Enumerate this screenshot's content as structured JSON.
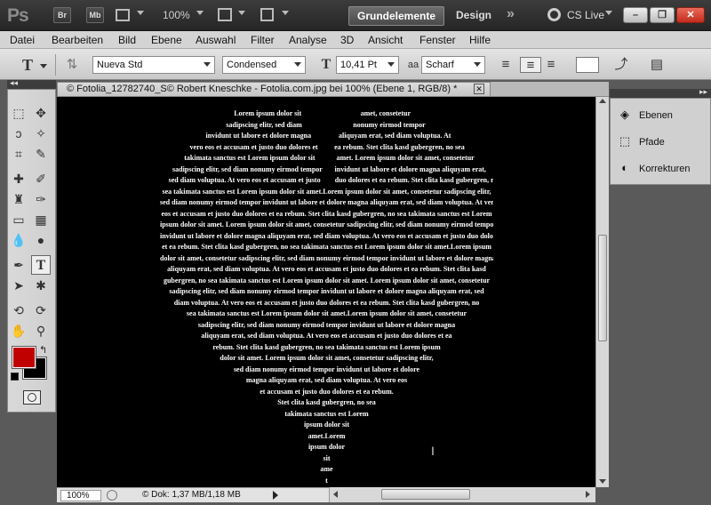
{
  "appbar": {
    "logo": "Ps",
    "br": "Br",
    "mb": "Mb",
    "zoom": "100%",
    "workspace_active": "Grundelemente",
    "workspace_design": "Design",
    "more": "»",
    "cslive": "CS Live"
  },
  "menu": [
    "Datei",
    "Bearbeiten",
    "Bild",
    "Ebene",
    "Auswahl",
    "Filter",
    "Analyse",
    "3D",
    "Ansicht",
    "Fenster",
    "Hilfe"
  ],
  "options": {
    "tool_glyph": "T",
    "font_family": "Nueva Std",
    "font_style": "Condensed",
    "font_size": "10,41 Pt",
    "aa_label": "aa",
    "antialias": "Scharf"
  },
  "document": {
    "tab_title": "© Fotolia_12782740_S© Robert Kneschke - Fotolia.com.jpg bei 100% (Ebene 1, RGB/8) *",
    "zoom": "100%",
    "doc_info": "© Dok: 1,37 MB/1,18 MB"
  },
  "text_lines": [
    [
      "Lorem ipsum dolor sit",
      "amet, consetetur"
    ],
    [
      "sadipscing elitr, sed diam",
      "nonumy eirmod tempor"
    ],
    [
      "invidunt ut labore et dolore magna",
      "aliquyam erat, sed diam voluptua. At"
    ],
    [
      "vero eos et accusam et justo duo dolores et",
      "ea rebum. Stet clita kasd gubergren, no sea"
    ],
    [
      "takimata sanctus est Lorem ipsum dolor sit",
      "amet. Lorem ipsum dolor sit amet, consetetur"
    ],
    [
      "sadipscing elitr, sed diam nonumy eirmod tempor",
      "invidunt ut labore et dolore magna aliquyam erat,"
    ],
    [
      "sed diam voluptua. At vero eos et accusam et justo",
      "duo dolores et ea rebum. Stet clita kasd gubergren, no"
    ],
    [
      "sea takimata sanctus est Lorem ipsum dolor sit amet.Lorem ipsum dolor sit amet, consetetur sadipscing elitr,"
    ],
    [
      "sed diam nonumy eirmod tempor invidunt ut labore et dolore magna aliquyam erat, sed diam voluptua. At vero"
    ],
    [
      "eos et accusam et justo duo dolores et ea rebum. Stet clita kasd gubergren, no sea takimata sanctus est Lorem"
    ],
    [
      "ipsum dolor sit amet. Lorem ipsum dolor sit amet, consetetur sadipscing elitr, sed diam nonumy eirmod tempor"
    ],
    [
      "invidunt ut labore et dolore magna aliquyam erat, sed diam voluptua. At vero eos et accusam et justo duo dolores"
    ],
    [
      "et ea rebum. Stet clita kasd gubergren, no sea takimata sanctus est Lorem ipsum dolor sit amet.Lorem ipsum"
    ],
    [
      "dolor sit amet, consetetur sadipscing elitr, sed diam nonumy eirmod tempor invidunt ut labore et dolore magna"
    ],
    [
      "aliquyam erat, sed diam voluptua. At vero eos et accusam et justo duo dolores et ea rebum. Stet clita kasd"
    ],
    [
      "gubergren, no sea takimata sanctus est Lorem ipsum dolor sit amet. Lorem ipsum dolor sit amet, consetetur"
    ],
    [
      "sadipscing elitr, sed diam nonumy eirmod tempor invidunt ut labore et dolore magna aliquyam erat, sed"
    ],
    [
      "diam voluptua. At vero eos et accusam et justo duo dolores et ea rebum. Stet clita kasd gubergren, no"
    ],
    [
      "sea takimata sanctus est Lorem ipsum dolor sit amet.Lorem ipsum dolor sit amet, consetetur"
    ],
    [
      "sadipscing elitr, sed diam nonumy eirmod tempor invidunt ut labore et dolore magna"
    ],
    [
      "aliquyam erat, sed diam voluptua. At vero eos et accusam et justo duo dolores et ea"
    ],
    [
      "rebum. Stet clita kasd gubergren, no sea takimata sanctus est Lorem ipsum"
    ],
    [
      "dolor sit amet. Lorem ipsum dolor sit amet, consetetur sadipscing elitr,"
    ],
    [
      "sed diam nonumy eirmod tempor invidunt ut labore et dolore"
    ],
    [
      "magna aliquyam erat, sed diam voluptua. At vero eos"
    ],
    [
      "et accusam et justo duo dolores et ea rebum."
    ],
    [
      "Stet clita kasd gubergren, no sea"
    ],
    [
      "takimata sanctus est Lorem"
    ],
    [
      "ipsum dolor sit"
    ],
    [
      "amet.Lorem"
    ],
    [
      "ipsum dolor"
    ],
    [
      "sit"
    ],
    [
      "ame"
    ],
    [
      "t"
    ]
  ],
  "panels": {
    "layers": "Ebenen",
    "paths": "Pfade",
    "corrections": "Korrekturen"
  },
  "colors": {
    "foreground": "#c00000",
    "background": "#000000",
    "canvas": "#000000"
  }
}
